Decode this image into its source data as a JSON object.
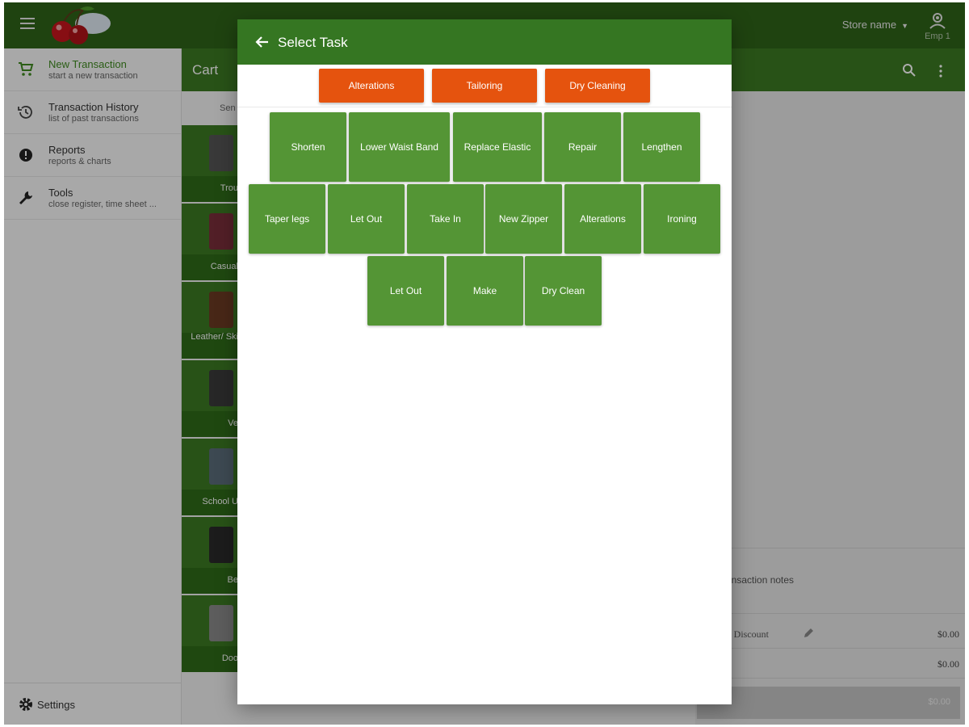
{
  "header": {
    "store_name": "Store name",
    "employee_label": "Emp 1"
  },
  "drawer": {
    "items": [
      {
        "title": "New Transaction",
        "subtitle": "start a new transaction",
        "icon": "cart-icon"
      },
      {
        "title": "Transaction History",
        "subtitle": "list of past transactions",
        "icon": "history-icon"
      },
      {
        "title": "Reports",
        "subtitle": "reports & charts",
        "icon": "alert-icon"
      },
      {
        "title": "Tools",
        "subtitle": "close register, time sheet ...",
        "icon": "wrench-icon"
      }
    ],
    "settings": "Settings"
  },
  "cart": {
    "title": "Cart",
    "subtab": "Sen",
    "categories": [
      "Trou",
      "Casual",
      "Leather/ Ski",
      "Ve",
      "School U",
      "Be",
      "Doo"
    ],
    "notes_label": "ansaction notes",
    "lines": [
      {
        "label": "e / Discount",
        "value": "$0.00"
      },
      {
        "label": "",
        "value": "$0.00"
      }
    ],
    "pay_value": "$0.00"
  },
  "dialog": {
    "title": "Select Task",
    "categories": [
      "Alterations",
      "Tailoring",
      "Dry Cleaning"
    ],
    "task_rows": [
      [
        "Shorten",
        "Lower Waist Band",
        "Replace Elastic",
        "Repair",
        "Lengthen"
      ],
      [
        "Taper legs",
        "Let Out",
        "Take In",
        "New Zipper",
        "Alterations",
        "Ironing"
      ],
      [
        "Let Out",
        "Make",
        "Dry Clean"
      ]
    ]
  },
  "colors": {
    "appbar": "#2e6419",
    "dialog_header": "#357622",
    "category_button": "#e5530e",
    "task_button": "#549535"
  }
}
